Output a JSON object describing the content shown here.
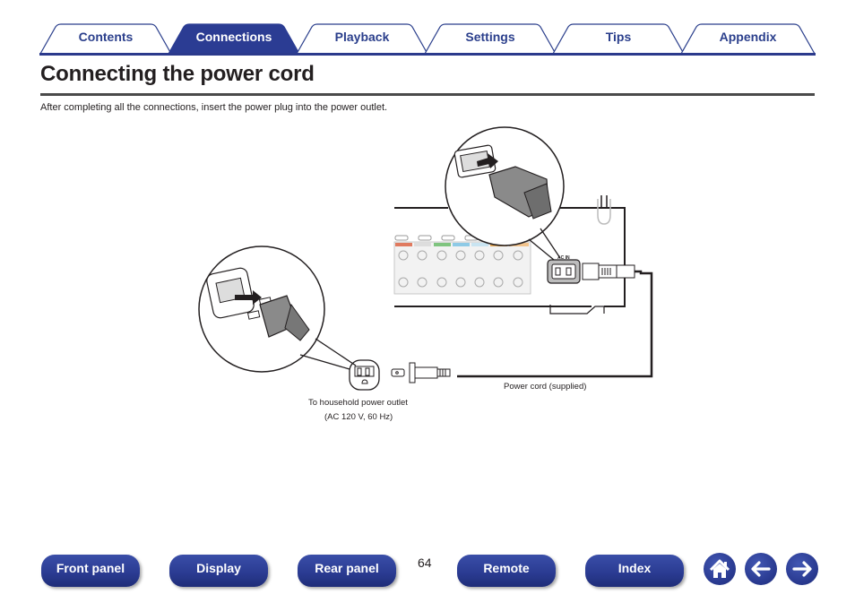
{
  "tabs": [
    {
      "label": "Contents",
      "active": false
    },
    {
      "label": "Connections",
      "active": true
    },
    {
      "label": "Playback",
      "active": false
    },
    {
      "label": "Settings",
      "active": false
    },
    {
      "label": "Tips",
      "active": false
    },
    {
      "label": "Appendix",
      "active": false
    }
  ],
  "page": {
    "title": "Connecting the power cord",
    "intro": "After completing all the connections, insert the power plug into the power outlet."
  },
  "figure": {
    "ac_in_label": "AC IN",
    "outlet_label_line1": "To household power outlet",
    "outlet_label_line2": "(AC 120 V, 60 Hz)",
    "cord_label": "Power cord (supplied)"
  },
  "footer": {
    "buttons": [
      {
        "label": "Front panel"
      },
      {
        "label": "Display"
      },
      {
        "label": "Rear panel"
      },
      {
        "label": "Remote"
      },
      {
        "label": "Index"
      }
    ],
    "page_number": "64",
    "icons": {
      "home": "home-icon",
      "back": "arrow-left-icon",
      "forward": "arrow-right-icon"
    }
  },
  "colors": {
    "brand_blue": "#2b3c93",
    "tab_text": "#2b3f8c",
    "text": "#231f20"
  }
}
